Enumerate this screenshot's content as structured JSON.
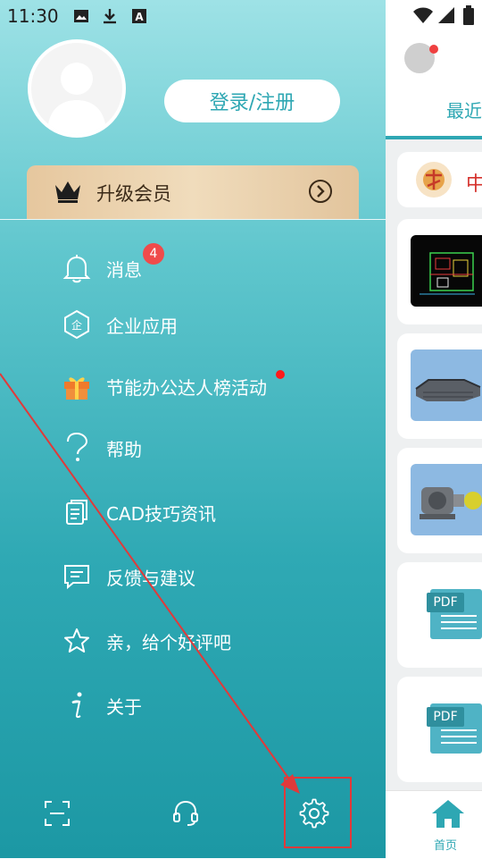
{
  "status_bar": {
    "time": "11:30"
  },
  "drawer": {
    "login_button": "登录/注册",
    "vip_label": "升级会员",
    "menu": [
      {
        "label": "消息",
        "badge": "4"
      },
      {
        "label": "企业应用"
      },
      {
        "label": "节能办公达人榜活动"
      },
      {
        "label": "帮助"
      },
      {
        "label": "CAD技巧资讯"
      },
      {
        "label": "反馈与建议"
      },
      {
        "label": "亲，给个好评吧"
      },
      {
        "label": "关于"
      }
    ]
  },
  "right_panel": {
    "tab_label": "最近",
    "banner_text": "中",
    "pdf_label": "PDF",
    "nav_home_label": "首页"
  },
  "colors": {
    "accent": "#2ea7b3",
    "badge": "#ef4b4b",
    "annotation": "#e03a3a"
  }
}
